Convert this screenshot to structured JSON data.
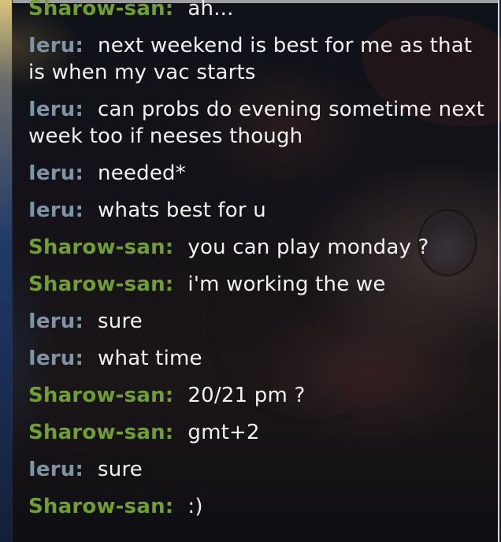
{
  "chat": {
    "messages": [
      {
        "sender": "Sharow-san:",
        "text": "ah...",
        "who": "sharow"
      },
      {
        "sender": "Ieru:",
        "text": "next weekend is best for me as that is when my vac starts",
        "who": "ieru"
      },
      {
        "sender": "Ieru:",
        "text": "can probs do evening sometime next week too if neeses though",
        "who": "ieru"
      },
      {
        "sender": "Ieru:",
        "text": "needed*",
        "who": "ieru"
      },
      {
        "sender": "Ieru:",
        "text": "whats best for u",
        "who": "ieru"
      },
      {
        "sender": "Sharow-san:",
        "text": "you can play monday ?",
        "who": "sharow"
      },
      {
        "sender": "Sharow-san:",
        "text": "i'm working the we",
        "who": "sharow"
      },
      {
        "sender": "Ieru:",
        "text": "sure",
        "who": "ieru"
      },
      {
        "sender": "Ieru:",
        "text": "what time",
        "who": "ieru"
      },
      {
        "sender": "Sharow-san:",
        "text": "20/21 pm ?",
        "who": "sharow"
      },
      {
        "sender": "Sharow-san:",
        "text": "gmt+2",
        "who": "sharow"
      },
      {
        "sender": "Ieru:",
        "text": "sure",
        "who": "ieru"
      },
      {
        "sender": "Sharow-san:",
        "text": ":)",
        "who": "sharow"
      }
    ]
  },
  "colors": {
    "sharow_name": "#6e9e34",
    "ieru_name": "#7c94a3",
    "message_text": "#f2f2f2"
  }
}
